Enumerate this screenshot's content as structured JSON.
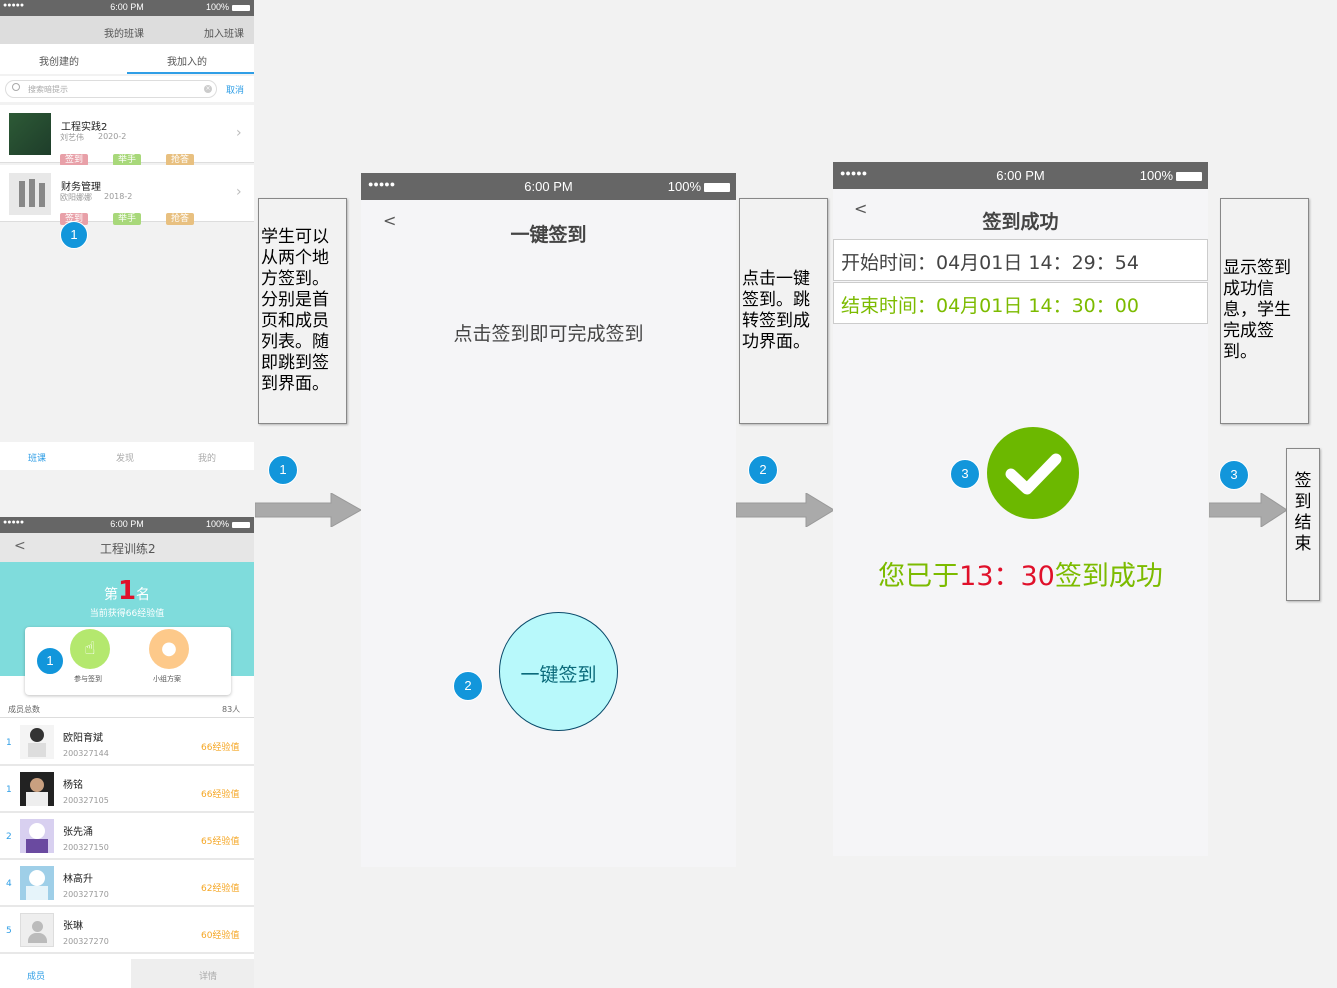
{
  "statusbar": {
    "dots": "●●●●● ",
    "time": "6:00 PM",
    "battery": "100%"
  },
  "screen1": {
    "header_title": "我的班课",
    "header_action": "加入班课",
    "tab_created": "我创建的",
    "tab_joined": "我加入的",
    "search_placeholder": "搜索暗提示",
    "search_cancel": "取消",
    "courses": [
      {
        "title": "工程实践2",
        "teacher": "刘艺伟",
        "term": "2020-2",
        "tags": [
          "签到",
          "举手",
          "抢答"
        ]
      },
      {
        "title": "财务管理",
        "teacher": "欧阳娜娜",
        "term": "2018-2",
        "tags": [
          "签到",
          "举手",
          "抢答"
        ]
      }
    ],
    "bottom_nav": [
      "班课",
      "发现",
      "我的"
    ]
  },
  "screen2": {
    "title": "工程训练2",
    "rank_prefix": "第",
    "rank_number": "1",
    "rank_suffix": "名",
    "exp_text": "当前获得66经验值",
    "action_checkin": "参与签到",
    "action_group": "小组方案",
    "members_label": "成员总数",
    "members_count": "83人",
    "members": [
      {
        "rank": "1",
        "name": "欧阳育斌",
        "id": "200327144",
        "exp": "66经验值"
      },
      {
        "rank": "1",
        "name": "杨铭",
        "id": "200327105",
        "exp": "66经验值"
      },
      {
        "rank": "2",
        "name": "张先涌",
        "id": "200327150",
        "exp": "65经验值"
      },
      {
        "rank": "4",
        "name": "林高升",
        "id": "200327170",
        "exp": "62经验值"
      },
      {
        "rank": "5",
        "name": "张琳",
        "id": "200327270",
        "exp": "60经验值"
      }
    ],
    "tab_members": "成员",
    "tab_detail": "详情"
  },
  "screen3": {
    "back": "<",
    "title": "一键签到",
    "instruction": "点击签到即可完成签到",
    "button": "一键签到"
  },
  "screen4": {
    "back": "<",
    "title": "签到成功",
    "start_time": "开始时间：04月01日 14：29：54",
    "end_time": "结束时间：04月01日 14：30：00",
    "success_part1": "您已于",
    "success_time": "13：30",
    "success_part2": "签到成功"
  },
  "notes": {
    "note1": "学生可以从两个地方签到。分别是首页和成员列表。随即跳到签到界面。",
    "note2": "点击一键签到。跳转签到成功界面。",
    "note3": "显示签到成功信息，学生完成签到。",
    "note4": "签到结束"
  },
  "badges": {
    "b1": "1",
    "b2": "2",
    "b3": "3"
  },
  "colors": {
    "statusbar": "#666666",
    "badge": "#1296db",
    "teal_header": "#7fdcdc",
    "success_green": "#7cbb00",
    "time_red": "#e0102a",
    "accent_tab": "#2f9ee6"
  }
}
